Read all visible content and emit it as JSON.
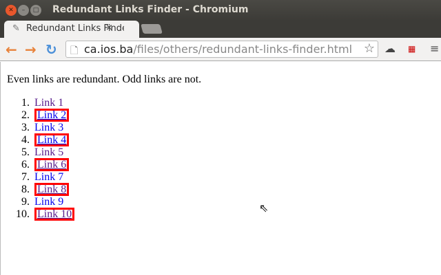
{
  "window": {
    "title": "Redundant Links Finder - Chromium"
  },
  "tab": {
    "label": "Redundant Links Finder",
    "close": "×"
  },
  "toolbar": {
    "back": "←",
    "forward": "→",
    "reload": "↻",
    "url_host": "ca.ios.ba",
    "url_path": "/files/others/redundant-links-finder.html"
  },
  "colors": {
    "redundant_border": "#ff0000",
    "link": "#0000ee",
    "visited": "#551a8b"
  },
  "page": {
    "intro": "Even links are redundant. Odd links are not.",
    "links": [
      {
        "num": "1.",
        "label": "Link 1",
        "redundant": false,
        "visited": true
      },
      {
        "num": "2.",
        "label": "Link 2",
        "redundant": true,
        "visited": false
      },
      {
        "num": "3.",
        "label": "Link 3",
        "redundant": false,
        "visited": false
      },
      {
        "num": "4.",
        "label": "Link 4",
        "redundant": true,
        "visited": false
      },
      {
        "num": "5.",
        "label": "Link 5",
        "redundant": false,
        "visited": true
      },
      {
        "num": "6.",
        "label": "Link 6",
        "redundant": true,
        "visited": true
      },
      {
        "num": "7.",
        "label": "Link 7",
        "redundant": false,
        "visited": false
      },
      {
        "num": "8.",
        "label": "Link 8",
        "redundant": true,
        "visited": true
      },
      {
        "num": "9.",
        "label": "Link 9",
        "redundant": false,
        "visited": false
      },
      {
        "num": "10.",
        "label": "Link 10",
        "redundant": true,
        "visited": true
      }
    ]
  }
}
